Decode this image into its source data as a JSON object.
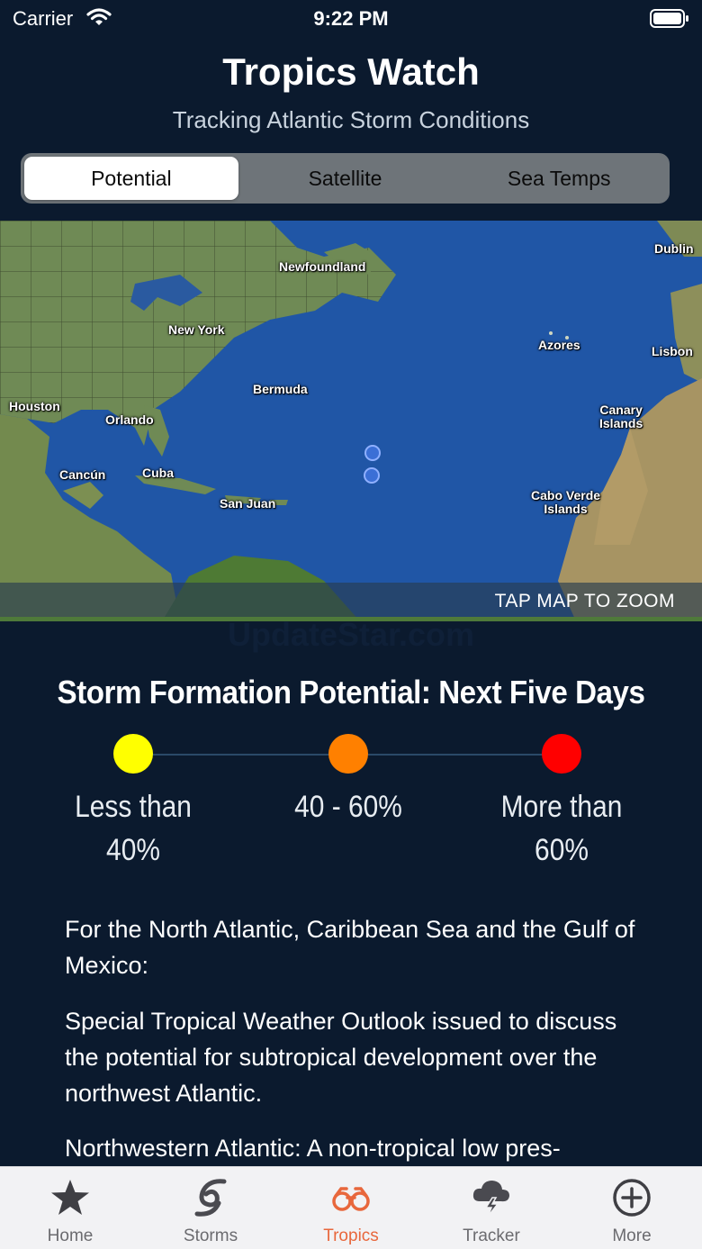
{
  "status": {
    "carrier": "Carrier",
    "time": "9:22 PM"
  },
  "header": {
    "title": "Tropics Watch",
    "subtitle": "Tracking Atlantic Storm Conditions"
  },
  "segments": [
    {
      "label": "Potential",
      "active": true
    },
    {
      "label": "Satellite",
      "active": false
    },
    {
      "label": "Sea Temps",
      "active": false
    }
  ],
  "map": {
    "places": {
      "newfoundland": "Newfoundland",
      "new_york": "New York",
      "bermuda": "Bermuda",
      "houston": "Houston",
      "orlando": "Orlando",
      "cancun": "Cancún",
      "cuba": "Cuba",
      "san_juan": "San Juan",
      "azores": "Azores",
      "dublin": "Dublin",
      "lisbon": "Lisbon",
      "canary": "Canary\nIslands",
      "cabo_verde": "Cabo Verde\nIslands"
    },
    "zoom_hint": "TAP MAP TO ZOOM",
    "watermark": "UpdateStar.com"
  },
  "legend": {
    "title": "Storm Formation Potential: Next Five Days",
    "low": {
      "label": "Less than 40%",
      "color": "#ffff00"
    },
    "mid": {
      "label": "40 - 60%",
      "color": "#ff8000"
    },
    "high": {
      "label": "More than 60%",
      "color": "#ff0000"
    }
  },
  "outlook": {
    "p1": "For the North Atlantic, Caribbean Sea and the Gulf of Mexico:",
    "p2": "Special Tropical Weather Outlook issued to discuss the potential for subtropical development over the northwest Atlantic.",
    "p3": "Northwestern Atlantic: A non-tropical low pres-"
  },
  "tabs": [
    {
      "label": "Home",
      "icon": "star-icon"
    },
    {
      "label": "Storms",
      "icon": "hurricane-icon"
    },
    {
      "label": "Tropics",
      "icon": "binoculars-icon",
      "active": true
    },
    {
      "label": "Tracker",
      "icon": "storm-cloud-icon"
    },
    {
      "label": "More",
      "icon": "plus-circle-icon"
    }
  ],
  "colors": {
    "background": "#0b1a2e",
    "accent": "#e8673c",
    "ocean": "#1f53a3"
  }
}
